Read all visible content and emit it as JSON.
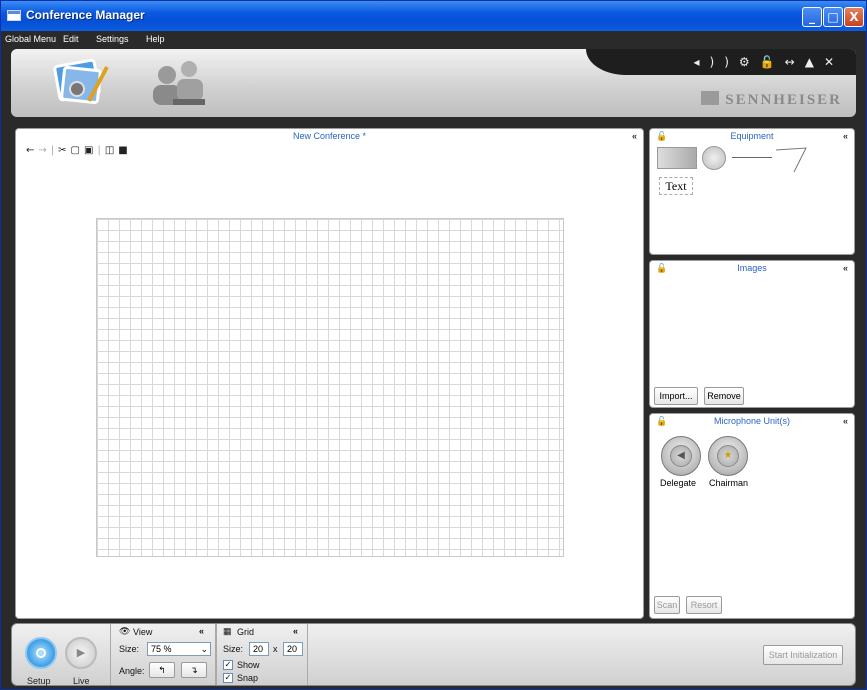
{
  "window": {
    "title": "Conference Manager",
    "minimize": "_",
    "maximize": "□",
    "close": "X"
  },
  "menu": [
    "Global Menu",
    "Edit",
    "Settings",
    "Help"
  ],
  "header": {
    "brand": "SENNHEISER",
    "icons": [
      "volume-icon",
      "settings-icon",
      "lock-icon",
      "network-icon",
      "eject-icon",
      "close-icon"
    ]
  },
  "main": {
    "title": "New Conference *"
  },
  "equipment": {
    "title": "Equipment",
    "text_tool": "Text"
  },
  "images": {
    "title": "Images",
    "import": "Import...",
    "remove": "Remove"
  },
  "microphones": {
    "title": "Microphone Unit(s)",
    "delegate": "Delegate",
    "chairman": "Chairman",
    "scan": "Scan",
    "resort": "Resort"
  },
  "bottom": {
    "setup": "Setup",
    "live": "Live",
    "view": {
      "title": "View",
      "size_label": "Size:",
      "size_value": "75 %",
      "angle_label": "Angle:"
    },
    "grid": {
      "title": "Grid",
      "size_label": "Size:",
      "w": "20",
      "x": "x",
      "h": "20",
      "show": "Show",
      "snap": "Snap"
    },
    "start": "Start Initialization"
  }
}
